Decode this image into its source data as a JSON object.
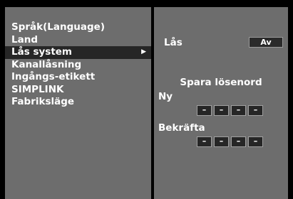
{
  "menu": {
    "items": [
      {
        "label": "Språk(Language)"
      },
      {
        "label": "Land"
      },
      {
        "label": "Lås system",
        "selected": true
      },
      {
        "label": "Kanallåsning"
      },
      {
        "label": "Ingångs-etikett"
      },
      {
        "label": "SIMPLINK"
      },
      {
        "label": "Fabriksläge"
      }
    ],
    "submenu_arrow": "▶"
  },
  "lock": {
    "label": "Lås",
    "value": "Av"
  },
  "password": {
    "title": "Spara lösenord",
    "new_label": "Ny",
    "confirm_label": "Bekräfta",
    "new_digits": [
      "–",
      "–",
      "–",
      "–"
    ],
    "confirm_digits": [
      "–",
      "–",
      "–",
      "–"
    ]
  },
  "colors": {
    "panel": "#6d6d6d",
    "background": "#000000",
    "selected": "#262626",
    "field": "#262626"
  }
}
